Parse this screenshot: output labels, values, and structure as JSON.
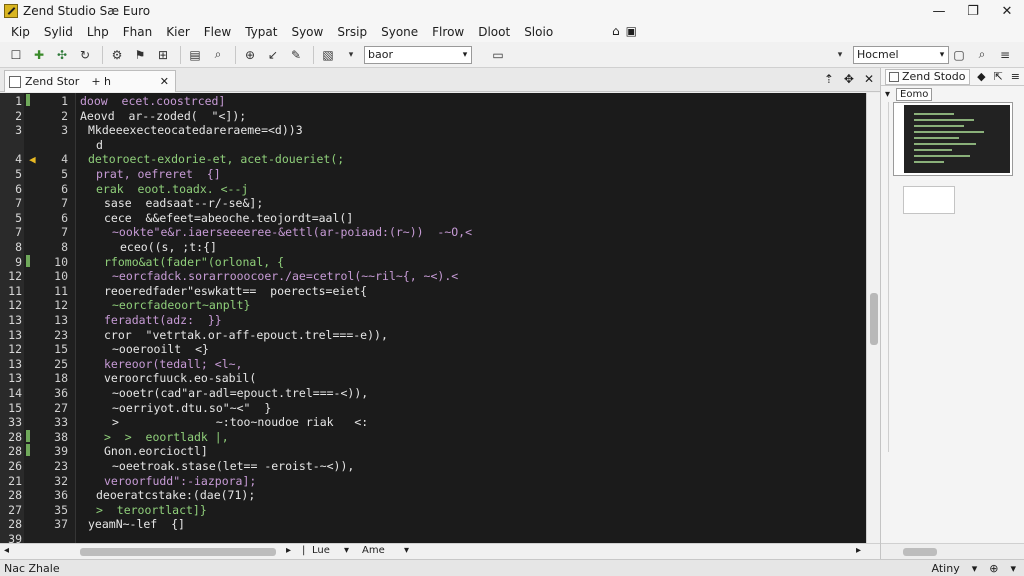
{
  "window": {
    "title": "Zend Studio Sæ Euro"
  },
  "menu": {
    "items": [
      "Kip",
      "Sylid",
      "Lhp",
      "Fhan",
      "Kier",
      "Flew",
      "Typat",
      "Syow",
      "Srsip",
      "Syone",
      "Flrow",
      "Dloot",
      "Sloio"
    ]
  },
  "toolbar": {
    "combo1_value": "baor",
    "combo2_value": "Hocmel"
  },
  "editor_tab": {
    "label": "Zend Stor"
  },
  "right_panel": {
    "tab_label": "Zend Stodo",
    "sub_label": "Eomo"
  },
  "hscroll": {
    "label1": "Lue",
    "label2": "Ame"
  },
  "status": {
    "left": "Nac Zhale",
    "right": "Atiny"
  },
  "code": [
    {
      "l1": "1",
      "l2": "1",
      "text": "doow  ecet.coostrced]",
      "color": "c-purple",
      "indent": 0,
      "mark": "",
      "green": true
    },
    {
      "l1": "2",
      "l2": "2",
      "text": "Aeovd  ar--zoded(  \"<]);",
      "color": "c-white",
      "indent": 0,
      "mark": "",
      "green": false
    },
    {
      "l1": "3",
      "l2": "3",
      "text": "Mkdeeexecteocatedareraeme=<d))3",
      "color": "c-white",
      "indent": 1,
      "mark": "",
      "green": false
    },
    {
      "l1": "",
      "l2": "",
      "text": "d",
      "color": "c-white",
      "indent": 2,
      "mark": "",
      "green": false
    },
    {
      "l1": "4",
      "l2": "4",
      "text": "detoroect-exdorie-et, acet-doueriet(;",
      "color": "c-green",
      "indent": 1,
      "mark": "◀",
      "green": false
    },
    {
      "l1": "5",
      "l2": "5",
      "text": "prat, oefreret  {]",
      "color": "c-purple",
      "indent": 2,
      "mark": "",
      "green": false
    },
    {
      "l1": "6",
      "l2": "6",
      "text": "erak  eoot.toadx. <--j",
      "color": "c-green",
      "indent": 2,
      "mark": "",
      "green": false
    },
    {
      "l1": "7",
      "l2": "7",
      "text": "sase  eadsaat--r/-se&];",
      "color": "c-white",
      "indent": 3,
      "mark": "",
      "green": false
    },
    {
      "l1": "5",
      "l2": "6",
      "text": "cece  &&efeet=abeoche.teojordt=aal(]",
      "color": "c-white",
      "indent": 3,
      "mark": "",
      "green": false
    },
    {
      "l1": "7",
      "l2": "7",
      "text": "~ookte\"e&r.iaerseeeeree-&ettl(ar-poiaad:(r~))  -~O,<",
      "color": "c-purple",
      "indent": 4,
      "mark": "",
      "green": false
    },
    {
      "l1": "8",
      "l2": "8",
      "text": "eceo((s, ;t:{]",
      "color": "c-white",
      "indent": 5,
      "mark": "",
      "green": false
    },
    {
      "l1": "9",
      "l2": "10",
      "text": "rfomo&at(fader\"(orlonal, {",
      "color": "c-green",
      "indent": 3,
      "mark": "",
      "green": true
    },
    {
      "l1": "12",
      "l2": "10",
      "text": "~eorcfadck.sorarrooocoer./ae=cetrol(~~ril~{, ~<).<",
      "color": "c-purple",
      "indent": 4,
      "mark": "",
      "green": false
    },
    {
      "l1": "11",
      "l2": "11",
      "text": "reoeredfader\"eswkatt==  poerects=eiet{",
      "color": "c-white",
      "indent": 3,
      "mark": "",
      "green": false
    },
    {
      "l1": "12",
      "l2": "12",
      "text": "~eorcfadeoort~anplt}",
      "color": "c-green",
      "indent": 4,
      "mark": "",
      "green": false
    },
    {
      "l1": "13",
      "l2": "13",
      "text": "feradatt(adz:  }}",
      "color": "c-purple",
      "indent": 3,
      "mark": "",
      "green": false
    },
    {
      "l1": "13",
      "l2": "23",
      "text": "cror  \"vetrtak.or-aff-epouct.trel===-e)),",
      "color": "c-white",
      "indent": 3,
      "mark": "",
      "green": false
    },
    {
      "l1": "12",
      "l2": "15",
      "text": "~ooerooilt  <}",
      "color": "c-white",
      "indent": 4,
      "mark": "",
      "green": false
    },
    {
      "l1": "13",
      "l2": "25",
      "text": "kereoor(tedall; <l~,",
      "color": "c-purple",
      "indent": 3,
      "mark": "",
      "green": false
    },
    {
      "l1": "13",
      "l2": "18",
      "text": "veroorcfuuck.eo-sabil(",
      "color": "c-white",
      "indent": 3,
      "mark": "",
      "green": false
    },
    {
      "l1": "14",
      "l2": "36",
      "text": "~ooetr(cad\"ar-adl=epouct.trel===-<)),",
      "color": "c-white",
      "indent": 4,
      "mark": "",
      "green": false
    },
    {
      "l1": "15",
      "l2": "27",
      "text": "~oerriyot.dtu.so\"~<\"  }",
      "color": "c-white",
      "indent": 4,
      "mark": "",
      "green": false
    },
    {
      "l1": "33",
      "l2": "33",
      "text": ">              ~:too~noudoe riak   <:",
      "color": "c-white",
      "indent": 4,
      "mark": "",
      "green": false
    },
    {
      "l1": "28",
      "l2": "38",
      "text": ">  >  eoortladk |,",
      "color": "c-green",
      "indent": 3,
      "mark": "",
      "green": true
    },
    {
      "l1": "28",
      "l2": "39",
      "text": "Gnon.eorcioctl]",
      "color": "c-white",
      "indent": 3,
      "mark": "",
      "green": true
    },
    {
      "l1": "26",
      "l2": "23",
      "text": "~oeetroak.stase(let== -eroist-~<)),",
      "color": "c-white",
      "indent": 4,
      "mark": "",
      "green": false
    },
    {
      "l1": "21",
      "l2": "32",
      "text": "veroorfudd\":-iazpora];",
      "color": "c-purple",
      "indent": 3,
      "mark": "",
      "green": false
    },
    {
      "l1": "28",
      "l2": "36",
      "text": "deoeratcstake:(dae(71);",
      "color": "c-white",
      "indent": 2,
      "mark": "",
      "green": false
    },
    {
      "l1": "27",
      "l2": "35",
      "text": ">  teroortlact]}",
      "color": "c-green",
      "indent": 2,
      "mark": "",
      "green": false
    },
    {
      "l1": "28",
      "l2": "37",
      "text": "yeamN~-lef  {]",
      "color": "c-white",
      "indent": 1,
      "mark": "",
      "green": false
    },
    {
      "l1": "39",
      "l2": "",
      "text": "",
      "color": "c-white",
      "indent": 0,
      "mark": "",
      "green": false
    }
  ]
}
